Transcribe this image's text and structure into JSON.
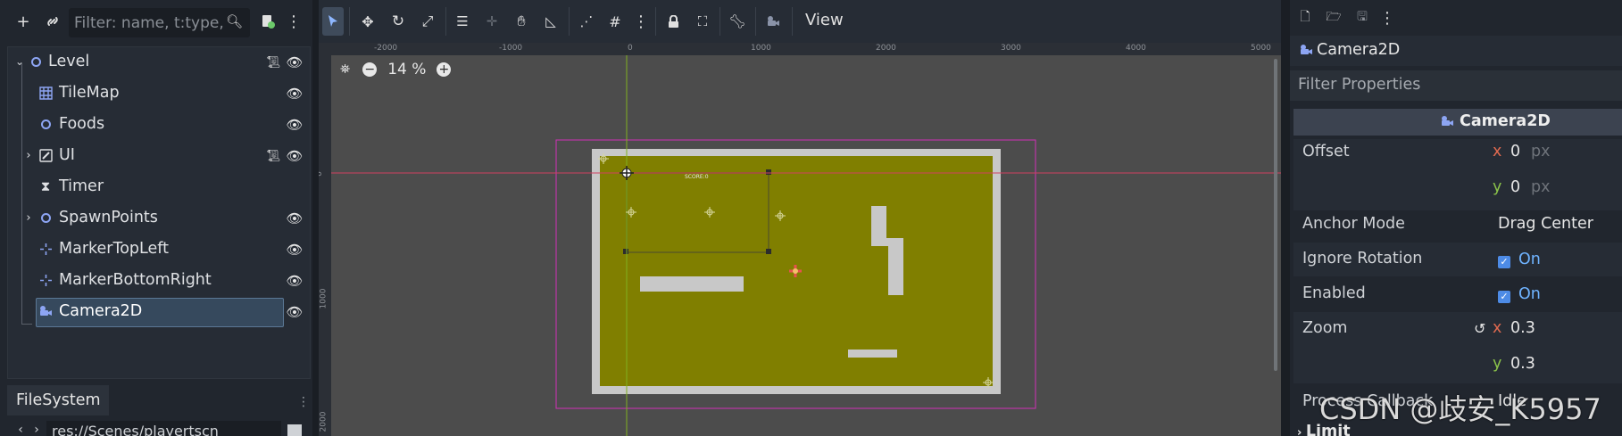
{
  "scene_dock": {
    "filter_placeholder": "Filter: name, t:type,",
    "tree": [
      {
        "label": "Level",
        "icon": "node-ring-icon",
        "has_script": true,
        "visible": true,
        "expandable": true
      },
      {
        "label": "TileMap",
        "icon": "tilemap-grid-icon",
        "has_script": false,
        "visible": true
      },
      {
        "label": "Foods",
        "icon": "node-ring-icon",
        "has_script": false,
        "visible": true
      },
      {
        "label": "UI",
        "icon": "control-edit-icon",
        "has_script": true,
        "visible": true,
        "expandable": true
      },
      {
        "label": "Timer",
        "icon": "hourglass-icon",
        "has_script": false,
        "visible": false
      },
      {
        "label": "SpawnPoints",
        "icon": "node-ring-icon",
        "has_script": false,
        "visible": true,
        "expandable": true
      },
      {
        "label": "MarkerTopLeft",
        "icon": "marker-icon",
        "has_script": false,
        "visible": true
      },
      {
        "label": "MarkerBottomRight",
        "icon": "marker-icon",
        "has_script": false,
        "visible": true
      },
      {
        "label": "Camera2D",
        "icon": "camera-icon",
        "has_script": false,
        "visible": true,
        "selected": true
      }
    ]
  },
  "filesystem": {
    "tab_label": "FileSystem",
    "path": "res://Scenes/playertscn"
  },
  "toolbar": {
    "view_label": "View"
  },
  "viewport": {
    "zoom_label": "14 %",
    "ruler_top": [
      "-2000",
      "-1000",
      "0",
      "1000",
      "2000",
      "3000",
      "4000",
      "5000"
    ],
    "ruler_left": [
      "0",
      "1000",
      "2000"
    ],
    "accent_colors": {
      "olive": "#807f00",
      "wall": "#c8c8c8",
      "camera_limit": "#d22fb8",
      "axis_x": "#d04060",
      "axis_y": "#7fb020"
    }
  },
  "inspector": {
    "node_name": "Camera2D",
    "filter_placeholder": "Filter Properties",
    "section_title": "Camera2D",
    "offset_label": "Offset",
    "offset_x_axis": "x",
    "offset_x": "0",
    "offset_unit_x": "px",
    "offset_y_axis": "y",
    "offset_y": "0",
    "offset_unit_y": "px",
    "anchor_mode_label": "Anchor Mode",
    "anchor_mode_value": "Drag Center",
    "ignore_rotation_label": "Ignore Rotation",
    "ignore_rotation_value": "On",
    "enabled_label": "Enabled",
    "enabled_value": "On",
    "zoom_label": "Zoom",
    "zoom_x_axis": "x",
    "zoom_x": "0.3",
    "zoom_y_axis": "y",
    "zoom_y": "0.3",
    "process_callback_label": "Process Callback",
    "process_callback_value": "Idle",
    "limit_label": "Limit",
    "watermark": "CSDN @歧安_K5957"
  }
}
